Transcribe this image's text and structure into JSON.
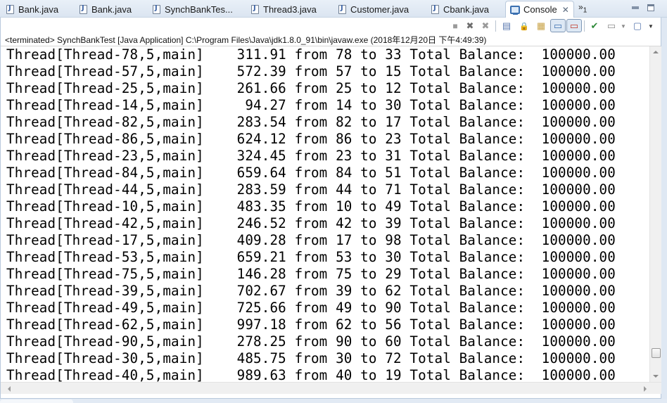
{
  "editor_tabs": [
    {
      "label": "Bank.java",
      "icon": "java-file-icon"
    },
    {
      "label": "Bank.java",
      "icon": "java-file-icon"
    },
    {
      "label": "SynchBankTes...",
      "icon": "java-file-icon"
    },
    {
      "label": "Thread3.java",
      "icon": "java-file-icon"
    },
    {
      "label": "Customer.java",
      "icon": "java-file-icon"
    },
    {
      "label": "Cbank.java",
      "icon": "java-file-icon"
    }
  ],
  "active_tab": {
    "label": "Console",
    "icon": "console-icon",
    "close": "✕"
  },
  "overflow": {
    "symbol": "»",
    "count": "1"
  },
  "toolbar": {
    "buttons": [
      {
        "name": "terminate",
        "icon": "stop-square-icon",
        "glyph": "■"
      },
      {
        "name": "remove-launch",
        "icon": "remove-x-icon",
        "glyph": "✖"
      },
      {
        "name": "remove-all-terminated",
        "icon": "remove-all-icon",
        "glyph": "✖"
      },
      {
        "name": "clear-console",
        "icon": "clear-console-icon",
        "glyph": "▤"
      },
      {
        "name": "scroll-lock",
        "icon": "scroll-lock-icon",
        "glyph": "🔒"
      },
      {
        "name": "word-wrap",
        "icon": "word-wrap-icon",
        "glyph": "▦"
      },
      {
        "name": "show-on-stdout",
        "icon": "show-stdout-icon",
        "glyph": "▭"
      },
      {
        "name": "show-on-stderr",
        "icon": "show-stderr-icon",
        "glyph": "▭"
      },
      {
        "name": "pin-console",
        "icon": "pin-console-icon",
        "glyph": "✔"
      },
      {
        "name": "display-selected-console",
        "icon": "display-console-icon",
        "glyph": "▭"
      },
      {
        "name": "open-console",
        "icon": "open-console-icon",
        "glyph": "▢"
      }
    ]
  },
  "status": "<terminated> SynchBankTest [Java Application] C:\\Program Files\\Java\\jdk1.8.0_91\\bin\\javaw.exe (2018年12月20日 下午4:49:39)",
  "console_lines": [
    {
      "thread": "Thread[Thread-78,5,main]",
      "amount": "311.91",
      "from": "78",
      "to": "33",
      "total": "100000.00"
    },
    {
      "thread": "Thread[Thread-57,5,main]",
      "amount": "572.39",
      "from": "57",
      "to": "15",
      "total": "100000.00"
    },
    {
      "thread": "Thread[Thread-25,5,main]",
      "amount": "261.66",
      "from": "25",
      "to": "12",
      "total": "100000.00"
    },
    {
      "thread": "Thread[Thread-14,5,main]",
      "amount": "94.27",
      "from": "14",
      "to": "30",
      "total": "100000.00"
    },
    {
      "thread": "Thread[Thread-82,5,main]",
      "amount": "283.54",
      "from": "82",
      "to": "17",
      "total": "100000.00"
    },
    {
      "thread": "Thread[Thread-86,5,main]",
      "amount": "624.12",
      "from": "86",
      "to": "23",
      "total": "100000.00"
    },
    {
      "thread": "Thread[Thread-23,5,main]",
      "amount": "324.45",
      "from": "23",
      "to": "31",
      "total": "100000.00"
    },
    {
      "thread": "Thread[Thread-84,5,main]",
      "amount": "659.64",
      "from": "84",
      "to": "51",
      "total": "100000.00"
    },
    {
      "thread": "Thread[Thread-44,5,main]",
      "amount": "283.59",
      "from": "44",
      "to": "71",
      "total": "100000.00"
    },
    {
      "thread": "Thread[Thread-10,5,main]",
      "amount": "483.35",
      "from": "10",
      "to": "49",
      "total": "100000.00"
    },
    {
      "thread": "Thread[Thread-42,5,main]",
      "amount": "246.52",
      "from": "42",
      "to": "39",
      "total": "100000.00"
    },
    {
      "thread": "Thread[Thread-17,5,main]",
      "amount": "409.28",
      "from": "17",
      "to": "98",
      "total": "100000.00"
    },
    {
      "thread": "Thread[Thread-53,5,main]",
      "amount": "659.21",
      "from": "53",
      "to": "30",
      "total": "100000.00"
    },
    {
      "thread": "Thread[Thread-75,5,main]",
      "amount": "146.28",
      "from": "75",
      "to": "29",
      "total": "100000.00"
    },
    {
      "thread": "Thread[Thread-39,5,main]",
      "amount": "702.67",
      "from": "39",
      "to": "62",
      "total": "100000.00"
    },
    {
      "thread": "Thread[Thread-49,5,main]",
      "amount": "725.66",
      "from": "49",
      "to": "90",
      "total": "100000.00"
    },
    {
      "thread": "Thread[Thread-62,5,main]",
      "amount": "997.18",
      "from": "62",
      "to": "56",
      "total": "100000.00"
    },
    {
      "thread": "Thread[Thread-90,5,main]",
      "amount": "278.25",
      "from": "90",
      "to": "60",
      "total": "100000.00"
    },
    {
      "thread": "Thread[Thread-30,5,main]",
      "amount": "485.75",
      "from": "30",
      "to": "72",
      "total": "100000.00"
    },
    {
      "thread": "Thread[Thread-40,5,main]",
      "amount": "989.63",
      "from": "40",
      "to": "19",
      "total": "100000.00"
    }
  ],
  "labels": {
    "from": "from",
    "to": "to",
    "total": "Total Balance:"
  },
  "scroll": {
    "vertical_position": 0.95
  }
}
